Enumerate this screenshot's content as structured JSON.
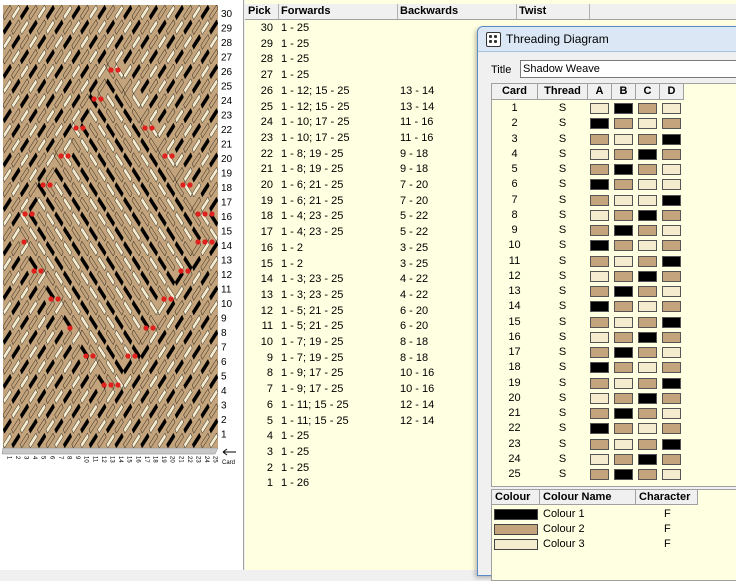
{
  "colors": {
    "c1": "#000000",
    "c2": "#c4a47c",
    "c3": "#f5ecd0",
    "marker": "#e0201c"
  },
  "pattern": {
    "right_labels": [
      "30",
      "29",
      "28",
      "27",
      "26",
      "25",
      "24",
      "23",
      "22",
      "21",
      "20",
      "19",
      "18",
      "17",
      "16",
      "15",
      "14",
      "13",
      "12",
      "11",
      "10",
      "9",
      "8",
      "7",
      "6",
      "5",
      "4",
      "3",
      "2",
      "1"
    ],
    "card_label": "Card"
  },
  "pick_table": {
    "headers": {
      "pick": "Pick",
      "forwards": "Forwards",
      "backwards": "Backwards",
      "twist": "Twist"
    },
    "rows": [
      {
        "pick": "30",
        "fwd": "1 - 25",
        "bwd": ""
      },
      {
        "pick": "29",
        "fwd": "1 - 25",
        "bwd": ""
      },
      {
        "pick": "28",
        "fwd": "1 - 25",
        "bwd": ""
      },
      {
        "pick": "27",
        "fwd": "1 - 25",
        "bwd": ""
      },
      {
        "pick": "26",
        "fwd": "1 - 12; 15 - 25",
        "bwd": "13 - 14"
      },
      {
        "pick": "25",
        "fwd": "1 - 12; 15 - 25",
        "bwd": "13 - 14"
      },
      {
        "pick": "24",
        "fwd": "1 - 10; 17 - 25",
        "bwd": "11 - 16"
      },
      {
        "pick": "23",
        "fwd": "1 - 10; 17 - 25",
        "bwd": "11 - 16"
      },
      {
        "pick": "22",
        "fwd": "1 - 8; 19 - 25",
        "bwd": "9 - 18"
      },
      {
        "pick": "21",
        "fwd": "1 - 8; 19 - 25",
        "bwd": "9 - 18"
      },
      {
        "pick": "20",
        "fwd": "1 - 6; 21 - 25",
        "bwd": "7 - 20"
      },
      {
        "pick": "19",
        "fwd": "1 - 6; 21 - 25",
        "bwd": "7 - 20"
      },
      {
        "pick": "18",
        "fwd": "1 - 4; 23 - 25",
        "bwd": "5 - 22"
      },
      {
        "pick": "17",
        "fwd": "1 - 4; 23 - 25",
        "bwd": "5 - 22"
      },
      {
        "pick": "16",
        "fwd": "1 - 2",
        "bwd": "3 - 25"
      },
      {
        "pick": "15",
        "fwd": "1 - 2",
        "bwd": "3 - 25"
      },
      {
        "pick": "14",
        "fwd": "1 - 3; 23 - 25",
        "bwd": "4 - 22"
      },
      {
        "pick": "13",
        "fwd": "1 - 3; 23 - 25",
        "bwd": "4 - 22"
      },
      {
        "pick": "12",
        "fwd": "1 - 5; 21 - 25",
        "bwd": "6 - 20"
      },
      {
        "pick": "11",
        "fwd": "1 - 5; 21 - 25",
        "bwd": "6 - 20"
      },
      {
        "pick": "10",
        "fwd": "1 - 7; 19 - 25",
        "bwd": "8 - 18"
      },
      {
        "pick": "9",
        "fwd": "1 - 7; 19 - 25",
        "bwd": "8 - 18"
      },
      {
        "pick": "8",
        "fwd": "1 - 9; 17 - 25",
        "bwd": "10 - 16"
      },
      {
        "pick": "7",
        "fwd": "1 - 9; 17 - 25",
        "bwd": "10 - 16"
      },
      {
        "pick": "6",
        "fwd": "1 - 11; 15 - 25",
        "bwd": "12 - 14"
      },
      {
        "pick": "5",
        "fwd": "1 - 11; 15 - 25",
        "bwd": "12 - 14"
      },
      {
        "pick": "4",
        "fwd": "1 - 25",
        "bwd": ""
      },
      {
        "pick": "3",
        "fwd": "1 - 25",
        "bwd": ""
      },
      {
        "pick": "2",
        "fwd": "1 - 25",
        "bwd": ""
      },
      {
        "pick": "1",
        "fwd": "1 - 26",
        "bwd": ""
      }
    ]
  },
  "dialog": {
    "title": "Threading Diagram",
    "title_label": "Title",
    "title_value": "Shadow Weave",
    "grid_headers": {
      "card": "Card",
      "thread": "Thread",
      "a": "A",
      "b": "B",
      "c": "C",
      "d": "D"
    },
    "cards": [
      {
        "card": "1",
        "thread": "S",
        "holes": [
          3,
          1,
          2,
          3
        ]
      },
      {
        "card": "2",
        "thread": "S",
        "holes": [
          1,
          2,
          3,
          2
        ]
      },
      {
        "card": "3",
        "thread": "S",
        "holes": [
          2,
          3,
          2,
          1
        ]
      },
      {
        "card": "4",
        "thread": "S",
        "holes": [
          3,
          2,
          1,
          2
        ]
      },
      {
        "card": "5",
        "thread": "S",
        "holes": [
          2,
          1,
          2,
          3
        ]
      },
      {
        "card": "6",
        "thread": "S",
        "holes": [
          1,
          2,
          3,
          3
        ]
      },
      {
        "card": "7",
        "thread": "S",
        "holes": [
          2,
          3,
          3,
          1
        ]
      },
      {
        "card": "8",
        "thread": "S",
        "holes": [
          3,
          2,
          1,
          2
        ]
      },
      {
        "card": "9",
        "thread": "S",
        "holes": [
          2,
          1,
          2,
          3
        ]
      },
      {
        "card": "10",
        "thread": "S",
        "holes": [
          1,
          2,
          3,
          2
        ]
      },
      {
        "card": "11",
        "thread": "S",
        "holes": [
          2,
          3,
          2,
          1
        ]
      },
      {
        "card": "12",
        "thread": "S",
        "holes": [
          3,
          2,
          1,
          2
        ]
      },
      {
        "card": "13",
        "thread": "S",
        "holes": [
          2,
          1,
          2,
          3
        ]
      },
      {
        "card": "14",
        "thread": "S",
        "holes": [
          1,
          2,
          3,
          2
        ]
      },
      {
        "card": "15",
        "thread": "S",
        "holes": [
          2,
          3,
          2,
          1
        ]
      },
      {
        "card": "16",
        "thread": "S",
        "holes": [
          3,
          2,
          1,
          2
        ]
      },
      {
        "card": "17",
        "thread": "S",
        "holes": [
          2,
          1,
          2,
          3
        ]
      },
      {
        "card": "18",
        "thread": "S",
        "holes": [
          1,
          2,
          3,
          2
        ]
      },
      {
        "card": "19",
        "thread": "S",
        "holes": [
          2,
          3,
          2,
          1
        ]
      },
      {
        "card": "20",
        "thread": "S",
        "holes": [
          3,
          2,
          1,
          2
        ]
      },
      {
        "card": "21",
        "thread": "S",
        "holes": [
          2,
          1,
          2,
          3
        ]
      },
      {
        "card": "22",
        "thread": "S",
        "holes": [
          1,
          2,
          3,
          2
        ]
      },
      {
        "card": "23",
        "thread": "S",
        "holes": [
          2,
          3,
          2,
          1
        ]
      },
      {
        "card": "24",
        "thread": "S",
        "holes": [
          3,
          2,
          1,
          2
        ]
      },
      {
        "card": "25",
        "thread": "S",
        "holes": [
          2,
          1,
          2,
          3
        ]
      }
    ],
    "colour_headers": {
      "colour": "Colour",
      "name": "Colour Name",
      "character": "Character"
    },
    "colours": [
      {
        "name": "Colour 1",
        "character": "F",
        "color": "#000000"
      },
      {
        "name": "Colour 2",
        "character": "F",
        "color": "#c4a47c"
      },
      {
        "name": "Colour 3",
        "character": "F",
        "color": "#f5ecd0"
      }
    ]
  }
}
